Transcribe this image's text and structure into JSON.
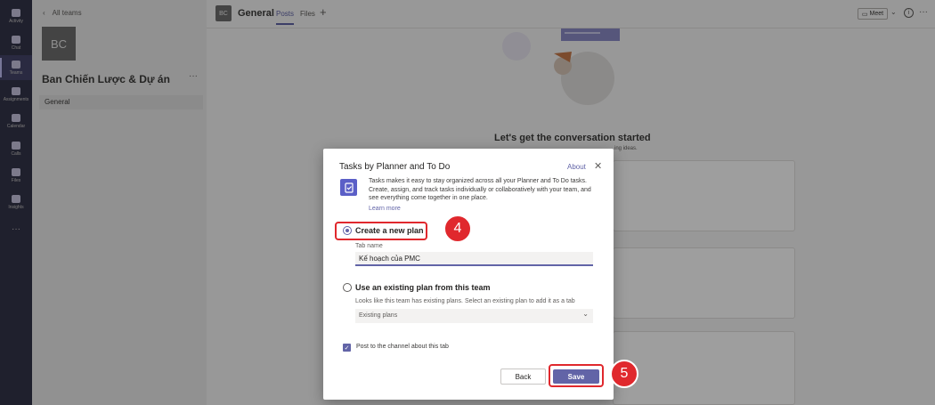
{
  "rail": {
    "items": [
      {
        "label": "Activity",
        "icon": "bell-icon"
      },
      {
        "label": "Chat",
        "icon": "chat-icon"
      },
      {
        "label": "Teams",
        "icon": "teams-icon"
      },
      {
        "label": "Assignments",
        "icon": "assignments-icon"
      },
      {
        "label": "Calendar",
        "icon": "calendar-icon"
      },
      {
        "label": "Calls",
        "icon": "phone-icon"
      },
      {
        "label": "Files",
        "icon": "file-icon"
      },
      {
        "label": "Insights",
        "icon": "lightbulb-icon"
      }
    ],
    "more": "···",
    "active_index": 2
  },
  "team": {
    "back_label": "All teams",
    "avatar_initials": "BC",
    "name": "Ban Chiến Lược & Dự án",
    "more": "···",
    "channels": [
      "General"
    ]
  },
  "header": {
    "channel_title": "General",
    "tabs": [
      "Posts",
      "Files"
    ],
    "add_tab": "+",
    "meet_label": "Meet"
  },
  "main": {
    "conversation_title": "Let's get the conversation started",
    "conversation_sub": "ing ideas."
  },
  "dialog": {
    "title": "Tasks by Planner and To Do",
    "about": "About",
    "description": "Tasks makes it easy to stay organized across all your Planner and To Do tasks. Create, assign, and track tasks individually or collaboratively with your team, and see everything come together in one place.",
    "learn_more": "Learn more",
    "option_new": "Create a new plan",
    "tab_name_label": "Tab name",
    "tab_name_value": "Kế hoạch của PMC",
    "option_existing": "Use an existing plan from this team",
    "existing_hint": "Looks like this team has existing plans. Select an existing plan to add it as a tab",
    "existing_select": "Existing plans",
    "post_checkbox": "Post to the channel about this tab",
    "back_button": "Back",
    "save_button": "Save"
  },
  "annotations": {
    "step4": "4",
    "step5": "5"
  },
  "colors": {
    "accent": "#6264a7",
    "highlight": "#e0282d",
    "rail": "#33344a"
  }
}
